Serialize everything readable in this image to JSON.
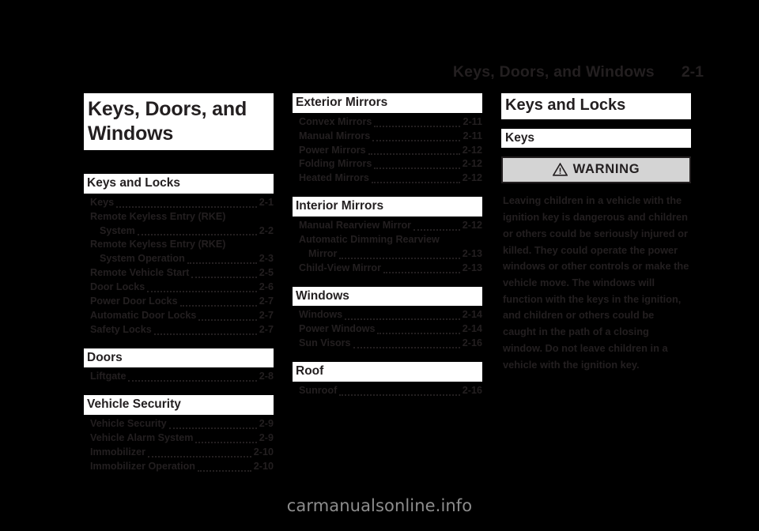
{
  "header": {
    "title": "Keys, Doors, and Windows",
    "page_number": "2-1"
  },
  "chapter": {
    "title": "Keys, Doors, and Windows"
  },
  "toc": {
    "groups": [
      {
        "heading": "Keys and Locks",
        "entries": [
          {
            "label": "Keys",
            "page": "2-1",
            "continuation": false,
            "leader": true
          },
          {
            "label": "Remote Keyless Entry (RKE)",
            "page": "",
            "continuation": false,
            "leader": false
          },
          {
            "label": "System",
            "page": "2-2",
            "continuation": true,
            "leader": true
          },
          {
            "label": "Remote Keyless Entry (RKE)",
            "page": "",
            "continuation": false,
            "leader": false
          },
          {
            "label": "System Operation",
            "page": "2-3",
            "continuation": true,
            "leader": true
          },
          {
            "label": "Remote Vehicle Start",
            "page": "2-5",
            "continuation": false,
            "leader": true
          },
          {
            "label": "Door Locks",
            "page": "2-6",
            "continuation": false,
            "leader": true
          },
          {
            "label": "Power Door Locks",
            "page": "2-7",
            "continuation": false,
            "leader": true
          },
          {
            "label": "Automatic Door Locks",
            "page": "2-7",
            "continuation": false,
            "leader": true
          },
          {
            "label": "Safety Locks",
            "page": "2-7",
            "continuation": false,
            "leader": true
          }
        ]
      },
      {
        "heading": "Doors",
        "entries": [
          {
            "label": "Liftgate",
            "page": "2-8",
            "continuation": false,
            "leader": true
          }
        ]
      },
      {
        "heading": "Vehicle Security",
        "entries": [
          {
            "label": "Vehicle Security",
            "page": "2-9",
            "continuation": false,
            "leader": true
          },
          {
            "label": "Vehicle Alarm System",
            "page": "2-9",
            "continuation": false,
            "leader": true
          },
          {
            "label": "Immobilizer",
            "page": "2-10",
            "continuation": false,
            "leader": true
          },
          {
            "label": "Immobilizer Operation",
            "page": "2-10",
            "continuation": false,
            "leader": true
          }
        ]
      },
      {
        "heading": "Exterior Mirrors",
        "entries": [
          {
            "label": "Convex Mirrors",
            "page": "2-11",
            "continuation": false,
            "leader": true
          },
          {
            "label": "Manual Mirrors",
            "page": "2-11",
            "continuation": false,
            "leader": true
          },
          {
            "label": "Power Mirrors",
            "page": "2-12",
            "continuation": false,
            "leader": true
          },
          {
            "label": "Folding Mirrors",
            "page": "2-12",
            "continuation": false,
            "leader": true
          },
          {
            "label": "Heated Mirrors",
            "page": "2-12",
            "continuation": false,
            "leader": true
          }
        ]
      },
      {
        "heading": "Interior Mirrors",
        "entries": [
          {
            "label": "Manual Rearview Mirror",
            "page": "2-12",
            "continuation": false,
            "leader": true
          },
          {
            "label": "Automatic Dimming Rearview",
            "page": "",
            "continuation": false,
            "leader": false
          },
          {
            "label": "Mirror",
            "page": "2-13",
            "continuation": true,
            "leader": true
          },
          {
            "label": "Child-View Mirror",
            "page": "2-13",
            "continuation": false,
            "leader": true
          }
        ]
      },
      {
        "heading": "Windows",
        "entries": [
          {
            "label": "Windows",
            "page": "2-14",
            "continuation": false,
            "leader": true
          },
          {
            "label": "Power Windows",
            "page": "2-14",
            "continuation": false,
            "leader": true
          },
          {
            "label": "Sun Visors",
            "page": "2-16",
            "continuation": false,
            "leader": true
          }
        ]
      },
      {
        "heading": "Roof",
        "entries": [
          {
            "label": "Sunroof",
            "page": "2-16",
            "continuation": false,
            "leader": true
          }
        ]
      }
    ]
  },
  "content": {
    "section_title": "Keys and Locks",
    "subsection_title": "Keys",
    "warning": {
      "icon": "warning-triangle-icon",
      "label": "WARNING",
      "body": "Leaving children in a vehicle with the ignition key is dangerous and children or others could be seriously injured or killed. They could operate the power windows or other controls or make the vehicle move. The windows will function with the keys in the ignition, and children or others could be caught in the path of a closing window. Do not leave children in a vehicle with the ignition key."
    }
  },
  "footer": {
    "watermark": "carmanualsonline.info"
  },
  "colors": {
    "page_background": "#000000",
    "ink": "#231f20",
    "highlight": "#ffffff",
    "warning_fill": "#d4d4d4",
    "watermark": "#8d8d8d"
  }
}
